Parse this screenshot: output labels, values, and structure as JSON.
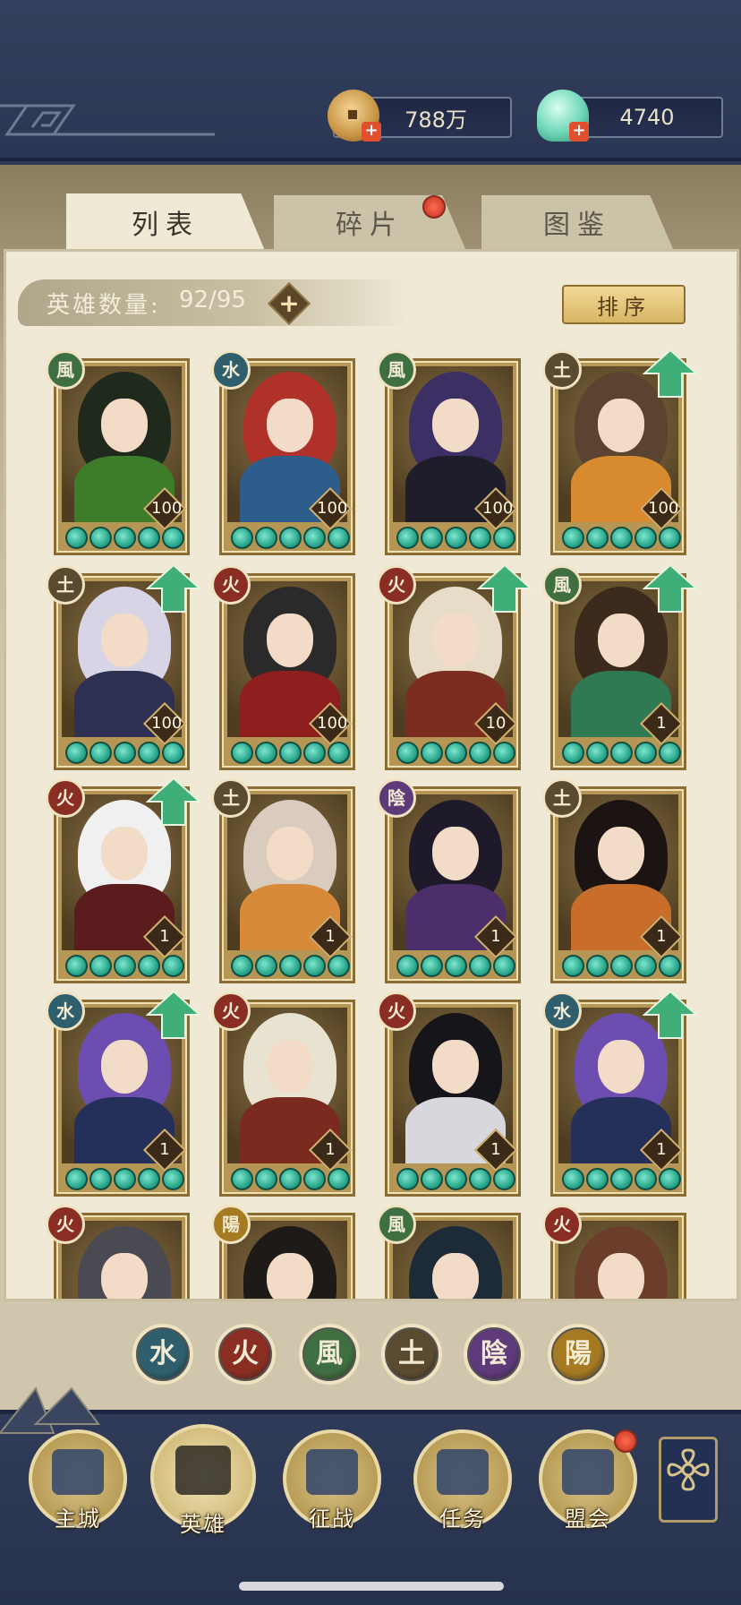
{
  "currency": {
    "coins": "788万",
    "gems": "4740",
    "coin_icon": "copper-coin-icon",
    "gem_icon": "jade-shell-icon"
  },
  "tabs": [
    {
      "label": "列表",
      "active": true
    },
    {
      "label": "碎片",
      "active": false,
      "badge": true
    },
    {
      "label": "图鉴",
      "active": false
    }
  ],
  "hero_count": {
    "label": "英雄数量:",
    "value": "92/95"
  },
  "sort_label": "排序",
  "heroes": [
    {
      "element": "風",
      "el_color": "#3f6f41",
      "level": "100",
      "up": false,
      "hair": "#1f2a1c",
      "outfit": "#3d7d2a"
    },
    {
      "element": "水",
      "el_color": "#2f5f6d",
      "level": "100",
      "up": false,
      "hair": "#b0302a",
      "outfit": "#2d5d8a"
    },
    {
      "element": "風",
      "el_color": "#3f6f41",
      "level": "100",
      "up": false,
      "hair": "#3b2f63",
      "outfit": "#1e1e2a"
    },
    {
      "element": "土",
      "el_color": "#5a4a30",
      "level": "100",
      "up": true,
      "hair": "#5a4330",
      "outfit": "#d78a2e"
    },
    {
      "element": "土",
      "el_color": "#5a4a30",
      "level": "100",
      "up": true,
      "hair": "#d7d4e6",
      "outfit": "#2d3050"
    },
    {
      "element": "火",
      "el_color": "#8a2e24",
      "level": "100",
      "up": false,
      "hair": "#2a2a2a",
      "outfit": "#8f1e1e"
    },
    {
      "element": "火",
      "el_color": "#8a2e24",
      "level": "10",
      "up": true,
      "hair": "#e6dcc8",
      "outfit": "#7b2e20"
    },
    {
      "element": "風",
      "el_color": "#3f6f41",
      "level": "1",
      "up": true,
      "hair": "#3c2a1c",
      "outfit": "#2f7a52"
    },
    {
      "element": "火",
      "el_color": "#8a2e24",
      "level": "1",
      "up": true,
      "hair": "#f0f0f0",
      "outfit": "#5a1c1c"
    },
    {
      "element": "土",
      "el_color": "#5a4a30",
      "level": "1",
      "up": false,
      "hair": "#d9ccbe",
      "outfit": "#d68a3a"
    },
    {
      "element": "陰",
      "el_color": "#5e3a7a",
      "level": "1",
      "up": false,
      "hair": "#1e1a2a",
      "outfit": "#4b2e6a"
    },
    {
      "element": "土",
      "el_color": "#5a4a30",
      "level": "1",
      "up": false,
      "hair": "#1c1412",
      "outfit": "#c86d2a"
    },
    {
      "element": "水",
      "el_color": "#2f5f6d",
      "level": "1",
      "up": true,
      "hair": "#6c4eb0",
      "outfit": "#24305a"
    },
    {
      "element": "火",
      "el_color": "#8a2e24",
      "level": "1",
      "up": false,
      "hair": "#e8e2d0",
      "outfit": "#7a2a1f"
    },
    {
      "element": "火",
      "el_color": "#8a2e24",
      "level": "1",
      "up": false,
      "hair": "#15151a",
      "outfit": "#d7d7de"
    },
    {
      "element": "水",
      "el_color": "#2f5f6d",
      "level": "1",
      "up": true,
      "hair": "#6c4eb0",
      "outfit": "#24305a"
    },
    {
      "element": "火",
      "el_color": "#8a2e24",
      "level": "",
      "up": false,
      "hair": "#4a4a52",
      "outfit": "#333"
    },
    {
      "element": "陽",
      "el_color": "#a57a22",
      "level": "",
      "up": false,
      "hair": "#1e1a18",
      "outfit": "#d7c69a"
    },
    {
      "element": "風",
      "el_color": "#3f6f41",
      "level": "",
      "up": false,
      "hair": "#1d2a38",
      "outfit": "#2d4a5a"
    },
    {
      "element": "火",
      "el_color": "#8a2e24",
      "level": "",
      "up": false,
      "hair": "#6a3e2a",
      "outfit": "#7a4a2a"
    }
  ],
  "filters": [
    {
      "label": "水",
      "color": "#2f5f6d"
    },
    {
      "label": "火",
      "color": "#8a2e24"
    },
    {
      "label": "風",
      "color": "#3f6f41"
    },
    {
      "label": "土",
      "color": "#5a4a30"
    },
    {
      "label": "陰",
      "color": "#5e3a7a"
    },
    {
      "label": "陽",
      "color": "#a57a22"
    }
  ],
  "nav": [
    {
      "label": "主城",
      "icon": "castle-gate-icon",
      "active": false,
      "badge": false
    },
    {
      "label": "英雄",
      "icon": "hero-portrait-icon",
      "active": true,
      "badge": false
    },
    {
      "label": "征战",
      "icon": "battle-helmet-icon",
      "active": false,
      "badge": false
    },
    {
      "label": "任务",
      "icon": "quest-scroll-icon",
      "active": false,
      "badge": false
    },
    {
      "label": "盟会",
      "icon": "guild-hall-icon",
      "active": false,
      "badge": true
    }
  ],
  "more_icon": "flower-menu-icon"
}
